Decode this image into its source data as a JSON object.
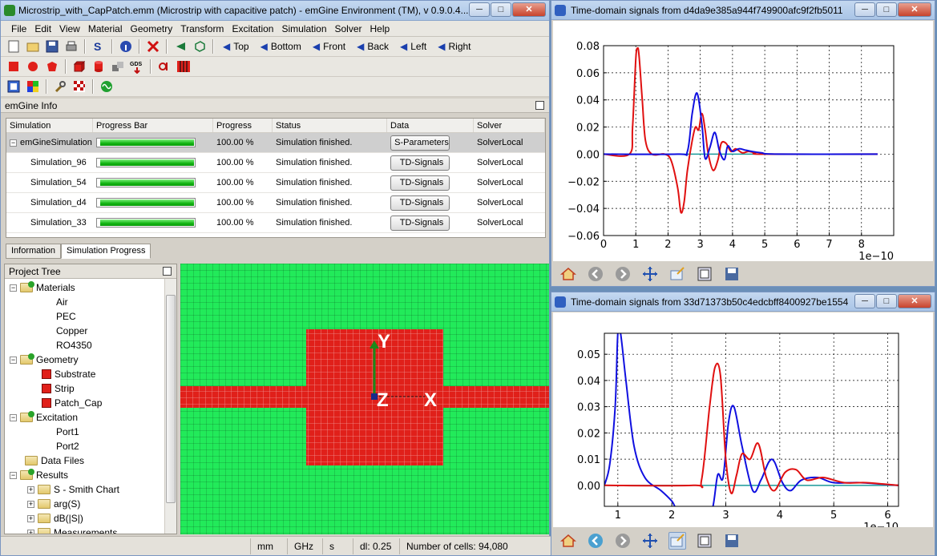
{
  "main_window": {
    "title": "Microstrip_with_CapPatch.emm (Microstrip with capacitive patch) - emGine Environment (TM), v 0.9.0.4...",
    "controls": {
      "min": "─",
      "max": "□",
      "close": "✕"
    }
  },
  "menu": [
    "File",
    "Edit",
    "View",
    "Material",
    "Geometry",
    "Transform",
    "Excitation",
    "Simulation",
    "Solver",
    "Help"
  ],
  "view_buttons": [
    "Top",
    "Bottom",
    "Front",
    "Back",
    "Left",
    "Right"
  ],
  "info_panel": {
    "title": "emGine Info",
    "columns": [
      "Simulation",
      "Progress Bar",
      "Progress",
      "Status",
      "Data",
      "Solver"
    ],
    "rows": [
      {
        "name": "emGineSimulation",
        "progress": "100.00 %",
        "progress_value": 1.0,
        "status": "Simulation finished.",
        "data": "S-Parameters",
        "solver": "SolverLocal"
      },
      {
        "name": "Simulation_96",
        "progress": "100.00 %",
        "progress_value": 1.0,
        "status": "Simulation finished.",
        "data": "TD-Signals",
        "solver": "SolverLocal"
      },
      {
        "name": "Simulation_54",
        "progress": "100.00 %",
        "progress_value": 1.0,
        "status": "Simulation finished.",
        "data": "TD-Signals",
        "solver": "SolverLocal"
      },
      {
        "name": "Simulation_d4",
        "progress": "100.00 %",
        "progress_value": 1.0,
        "status": "Simulation finished.",
        "data": "TD-Signals",
        "solver": "SolverLocal"
      },
      {
        "name": "Simulation_33",
        "progress": "100.00 %",
        "progress_value": 1.0,
        "status": "Simulation finished.",
        "data": "TD-Signals",
        "solver": "SolverLocal"
      }
    ],
    "tabs": [
      "Information",
      "Simulation Progress"
    ]
  },
  "project_tree": {
    "title": "Project Tree",
    "items": {
      "materials": "Materials",
      "air": "Air",
      "pec": "PEC",
      "copper": "Copper",
      "ro4350": "RO4350",
      "geometry": "Geometry",
      "substrate": "Substrate",
      "strip": "Strip",
      "patch_cap": "Patch_Cap",
      "excitation": "Excitation",
      "port1": "Port1",
      "port2": "Port2",
      "data_files": "Data Files",
      "results": "Results",
      "smith": "S - Smith Chart",
      "args": "arg(S)",
      "dbs": "dB(|S|)",
      "measurements": "Measurements"
    }
  },
  "viewport": {
    "axis_x": "X",
    "axis_y": "Y",
    "axis_z": "Z"
  },
  "status_bar": {
    "units": "mm",
    "freq": "GHz",
    "time": "s",
    "dl": "dl: 0.25",
    "cells": "Number of cells: 94,080"
  },
  "colors": {
    "grid_green": "#22ea5a",
    "metal_red": "#e0201a",
    "series_red": "#e01010",
    "series_blue": "#1010e0"
  },
  "chart_data": [
    {
      "type": "line",
      "window_title": "Time-domain signals from d4da9e385a944f749900afc9f2fb5011",
      "xlim": [
        0,
        9
      ],
      "ylim": [
        -0.06,
        0.08
      ],
      "xticks": [
        "0",
        "1",
        "2",
        "3",
        "4",
        "5",
        "6",
        "7",
        "8"
      ],
      "yticks": [
        "−0.06",
        "−0.04",
        "−0.02",
        "0.00",
        "0.02",
        "0.04",
        "0.06",
        "0.08"
      ],
      "x_offset_label": "1e−10",
      "grid": true,
      "series": [
        {
          "color": "#e01010",
          "x": [
            0,
            0.8,
            0.9,
            1.0,
            1.05,
            1.1,
            1.2,
            1.3,
            1.5,
            1.9,
            2.1,
            2.3,
            2.4,
            2.5,
            2.6,
            2.75,
            2.85,
            2.95,
            3.05,
            3.15,
            3.25,
            3.4,
            3.55,
            3.65,
            3.8,
            3.95,
            4.1,
            4.3,
            4.5,
            4.7,
            5.0,
            8.5
          ],
          "y": [
            0,
            0,
            0.02,
            0.07,
            0.078,
            0.073,
            0.04,
            0.01,
            0,
            0,
            -0.005,
            -0.025,
            -0.043,
            -0.035,
            -0.012,
            0.01,
            0.02,
            0.018,
            0.03,
            0.018,
            0,
            -0.012,
            -0.004,
            0.008,
            0.008,
            0.002,
            0.004,
            0.001,
            0.002,
            0.001,
            0,
            0
          ]
        },
        {
          "color": "#1010e0",
          "x": [
            0,
            2.3,
            2.6,
            2.75,
            2.9,
            3.05,
            3.15,
            3.3,
            3.45,
            3.6,
            3.75,
            3.85,
            4.0,
            4.2,
            4.4,
            4.6,
            4.9,
            5.4,
            8.5
          ],
          "y": [
            0,
            0,
            0.002,
            0.03,
            0.045,
            0.022,
            -0.003,
            0.005,
            0.016,
            0.002,
            -0.004,
            0.006,
            0.002,
            0.004,
            0.003,
            0.002,
            0.001,
            0,
            0
          ]
        }
      ]
    },
    {
      "type": "line",
      "window_title": "Time-domain signals from 33d71373b50c4edcbff8400927be1554",
      "xlim": [
        0.75,
        6.2
      ],
      "ylim": [
        -0.008,
        0.058
      ],
      "xticks": [
        "1",
        "2",
        "3",
        "4",
        "5",
        "6"
      ],
      "yticks": [
        "0.00",
        "0.01",
        "0.02",
        "0.03",
        "0.04",
        "0.05"
      ],
      "x_offset_label": "1e−10",
      "grid": true,
      "series": [
        {
          "color": "#1010e0",
          "x": [
            0.75,
            0.85,
            0.95,
            1.0,
            1.05,
            1.15,
            1.3,
            1.5,
            1.8,
            2.0,
            2.15,
            2.6,
            2.75,
            2.85,
            2.95,
            3.05,
            3.15,
            3.3,
            3.5,
            3.65,
            3.8,
            3.9,
            4.05,
            4.2,
            4.4,
            4.7,
            5.0,
            5.5,
            6.2
          ],
          "y": [
            0,
            0.008,
            0.03,
            0.058,
            0.058,
            0.04,
            0.015,
            0.003,
            -0.002,
            -0.006,
            -0.01,
            -0.01,
            -0.009,
            0.004,
            0.003,
            0.024,
            0.03,
            0.015,
            -0.002,
            0.002,
            0.009,
            0.009,
            0.001,
            -0.002,
            0.002,
            0.003,
            0.001,
            0.001,
            0
          ]
        },
        {
          "color": "#e01010",
          "x": [
            0.75,
            2.4,
            2.55,
            2.7,
            2.8,
            2.9,
            3.0,
            3.1,
            3.2,
            3.3,
            3.45,
            3.6,
            3.75,
            3.9,
            4.1,
            4.3,
            4.5,
            4.8,
            5.2,
            5.6,
            6.2
          ],
          "y": [
            0,
            0,
            0.002,
            0.03,
            0.045,
            0.042,
            0.01,
            -0.003,
            0.004,
            0.012,
            0.01,
            0.016,
            0.003,
            -0.002,
            0.005,
            0.006,
            0.002,
            0.003,
            0.001,
            0.001,
            0
          ]
        }
      ]
    }
  ]
}
